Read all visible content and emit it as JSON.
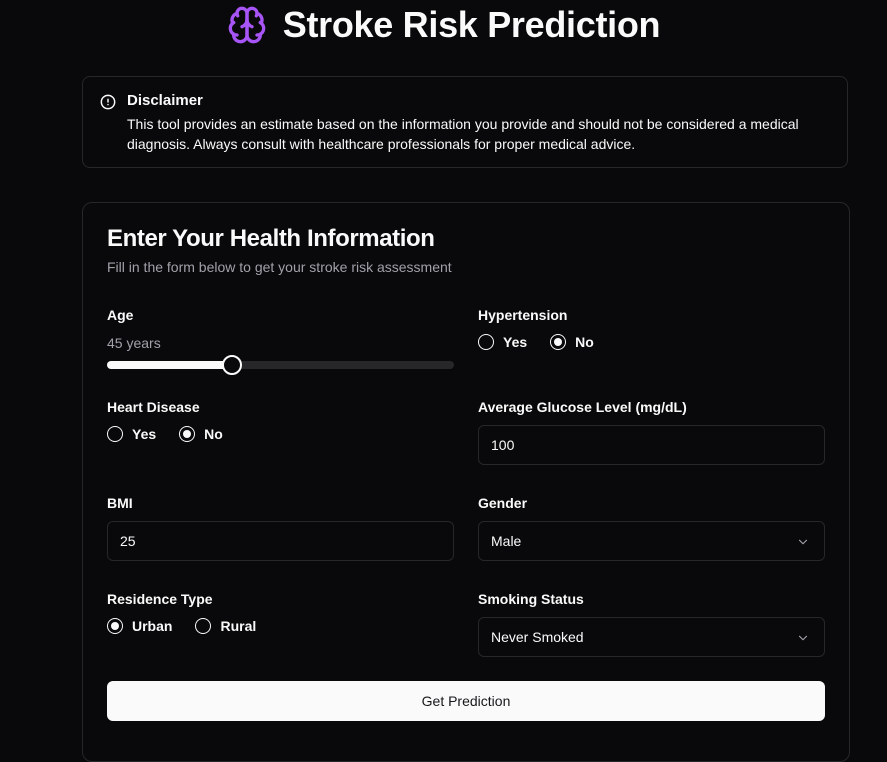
{
  "header": {
    "title": "Stroke Risk Prediction",
    "icon": "brain-icon",
    "accent_color": "#a855f7"
  },
  "disclaimer": {
    "icon": "alert-circle-icon",
    "title": "Disclaimer",
    "text": "This tool provides an estimate based on the information you provide and should not be considered a medical diagnosis. Always consult with healthcare professionals for proper medical advice."
  },
  "form": {
    "title": "Enter Your Health Information",
    "subtitle": "Fill in the form below to get your stroke risk assessment",
    "age": {
      "label": "Age",
      "value_text": "45 years",
      "value": 45,
      "fill_fraction": 0.36
    },
    "hypertension": {
      "label": "Hypertension",
      "options": [
        "Yes",
        "No"
      ],
      "selected": "No"
    },
    "heart_disease": {
      "label": "Heart Disease",
      "options": [
        "Yes",
        "No"
      ],
      "selected": "No"
    },
    "glucose": {
      "label": "Average Glucose Level (mg/dL)",
      "value": "100"
    },
    "bmi": {
      "label": "BMI",
      "value": "25"
    },
    "gender": {
      "label": "Gender",
      "value": "Male"
    },
    "residence": {
      "label": "Residence Type",
      "options": [
        "Urban",
        "Rural"
      ],
      "selected": "Urban"
    },
    "smoking": {
      "label": "Smoking Status",
      "value": "Never Smoked"
    },
    "submit_label": "Get Prediction"
  }
}
